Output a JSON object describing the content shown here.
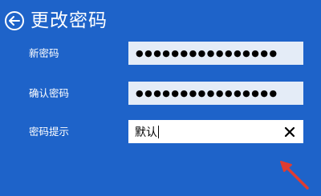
{
  "header": {
    "title": "更改密码",
    "back_icon": "back-arrow-circle-icon"
  },
  "form": {
    "new_password": {
      "label": "新密码",
      "value": "●●●●●●●●●●●●●●●●"
    },
    "confirm_password": {
      "label": "确认密码",
      "value": "●●●●●●●●●●●●●●●●"
    },
    "password_hint": {
      "label": "密码提示",
      "value": "默认",
      "clear_icon": "close-icon"
    }
  },
  "annotation": {
    "arrow_color": "#e03c31"
  },
  "colors": {
    "background": "#1e63c9",
    "field_background": "#e4ecf7",
    "text": "#ffffff"
  }
}
